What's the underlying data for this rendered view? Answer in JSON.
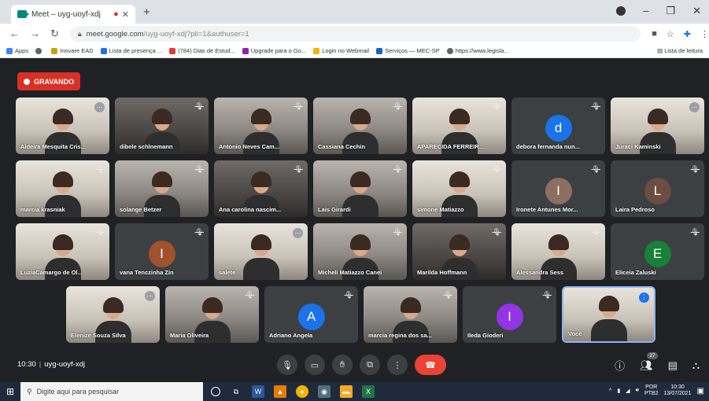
{
  "browser": {
    "tab_title": "Meet – uyg-uoyf-xdj",
    "address_host": "meet.google.com",
    "address_path": "/uyg-uoyf-xdj?pli=1&authuser=1",
    "bookmarks": [
      {
        "label": "Apps",
        "color": "#4285f4"
      },
      {
        "label": "",
        "color": "#5f6368"
      },
      {
        "label": "Inovare EAD",
        "color": "#c5a600"
      },
      {
        "label": "Lista de presença ...",
        "color": "#1a73e8"
      },
      {
        "label": "(784) Dias de Estud...",
        "color": "#e53935"
      },
      {
        "label": "Upgrade para o Go...",
        "color": "#8e24aa"
      },
      {
        "label": "Login no Webmail",
        "color": "#f4b400"
      },
      {
        "label": "Serviços — MEC-SP",
        "color": "#1565c0"
      },
      {
        "label": "https://www.legisla...",
        "color": "#5f6368"
      }
    ],
    "reading_list": "Lista de leitura"
  },
  "meet": {
    "recording_label": "GRAVANDO",
    "meeting_time": "10:30",
    "meeting_code": "uyg-uoyf-xdj",
    "participants_count": "27",
    "participants": [
      {
        "name": "Aldeíra Mesquita Cris...",
        "type": "video",
        "tone": "light",
        "mic": "on"
      },
      {
        "name": "dibele schlnemann",
        "type": "video",
        "tone": "dark",
        "mic": "off"
      },
      {
        "name": "Antonio Neves Cam...",
        "type": "video",
        "tone": "mid",
        "mic": "off"
      },
      {
        "name": "Cassiana Cechin",
        "type": "video",
        "tone": "mid",
        "mic": "off"
      },
      {
        "name": "APARECIDA FERREIR...",
        "type": "video",
        "tone": "light",
        "mic": "off"
      },
      {
        "name": "debora fernanda nun...",
        "type": "avatar",
        "letter": "d",
        "color": "#1a73e8",
        "mic": "off"
      },
      {
        "name": "Juraci Kaminski",
        "type": "video",
        "tone": "light",
        "mic": "on"
      },
      {
        "name": "marcia krasniak",
        "type": "video",
        "tone": "light",
        "mic": "off"
      },
      {
        "name": "solange Betzer",
        "type": "video",
        "tone": "mid",
        "mic": "off"
      },
      {
        "name": "Ana carolina nascim...",
        "type": "video",
        "tone": "dark",
        "mic": "off"
      },
      {
        "name": "Lais Girardi",
        "type": "video",
        "tone": "mid",
        "mic": "off"
      },
      {
        "name": "simone Matiazzo",
        "type": "video",
        "tone": "light",
        "mic": "off"
      },
      {
        "name": "Ironete Antunes Mor...",
        "type": "avatar",
        "letter": "I",
        "color": "#8d6e63",
        "mic": "off"
      },
      {
        "name": "Laira Pedroso",
        "type": "avatar",
        "letter": "L",
        "color": "#6d4c41",
        "mic": "off"
      },
      {
        "name": "LuziaCamargo de Ol...",
        "type": "video",
        "tone": "light",
        "mic": "off"
      },
      {
        "name": "vana Tenczinha Zin",
        "type": "avatar",
        "letter": "I",
        "color": "#a0522d",
        "mic": "off"
      },
      {
        "name": "salete",
        "type": "video",
        "tone": "light",
        "mic": "on"
      },
      {
        "name": "Micheli Matiazzo Canei",
        "type": "video",
        "tone": "mid",
        "mic": "off"
      },
      {
        "name": "Marilda Hoffmann",
        "type": "video",
        "tone": "dark",
        "mic": "off"
      },
      {
        "name": "Alessandra Sess",
        "type": "video",
        "tone": "light",
        "mic": "off"
      },
      {
        "name": "Eliceia Zaluski",
        "type": "avatar",
        "letter": "E",
        "color": "#188038",
        "mic": "off"
      },
      {
        "name": "Elenize Souza Silva",
        "type": "video",
        "tone": "light",
        "mic": "on"
      },
      {
        "name": "Maria Oliveira",
        "type": "video",
        "tone": "mid",
        "mic": "off"
      },
      {
        "name": "Adriano Angela",
        "type": "avatar",
        "letter": "A",
        "color": "#1a73e8",
        "mic": "off"
      },
      {
        "name": "marcia regina dos sa...",
        "type": "video",
        "tone": "mid",
        "mic": "off"
      },
      {
        "name": "Ileda Gioderi",
        "type": "avatar",
        "letter": "I",
        "color": "#9334e6",
        "mic": "off"
      },
      {
        "name": "Você",
        "type": "video",
        "tone": "light",
        "mic": "active",
        "self": true
      }
    ]
  },
  "taskbar": {
    "search_placeholder": "Digite aqui para pesquisar",
    "lang": "POR",
    "layout": "PTB2",
    "time": "10:30",
    "date": "13/07/2021"
  }
}
